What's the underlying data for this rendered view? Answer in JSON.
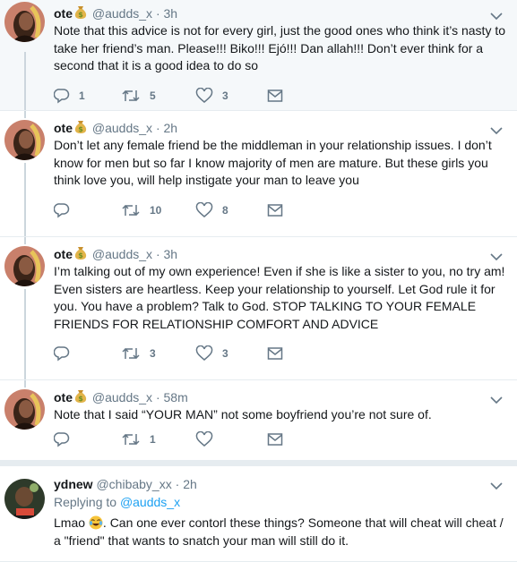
{
  "tweets": [
    {
      "name": "ote",
      "handle": "@audds_x",
      "dot": "·",
      "time": "3h",
      "text": "Note that this advice is not for every girl, just the good ones who think it’s nasty to take her friend’s man. Please!!! Biko!!! Ejó!!! Dan allah!!! Don’t ever think for a second that it is a good idea to do so",
      "replies": "1",
      "retweets": "5",
      "likes": "3"
    },
    {
      "name": "ote",
      "handle": "@audds_x",
      "dot": "·",
      "time": "2h",
      "text": "Don’t let any female friend be the middleman in your relationship issues. I don’t know for men but so far I know majority of men are mature. But these girls you think love you, will help instigate your man to leave you",
      "replies": "",
      "retweets": "10",
      "likes": "8"
    },
    {
      "name": "ote",
      "handle": "@audds_x",
      "dot": "·",
      "time": "3h",
      "text": "I’m talking out of my own experience! Even if she is like a sister to you, no try am! Even sisters are heartless. Keep your relationship to yourself. Let God rule it for you. You have a problem? Talk to God. STOP TALKING TO YOUR FEMALE FRIENDS FOR RELATIONSHIP COMFORT AND ADVICE",
      "replies": "",
      "retweets": "3",
      "likes": "3"
    },
    {
      "name": "ote",
      "handle": "@audds_x",
      "dot": "·",
      "time": "58m",
      "text": "Note that I said “YOUR MAN” not some boyfriend you’re not sure of.",
      "replies": "",
      "retweets": "1",
      "likes": ""
    },
    {
      "name": "ydnew",
      "handle": "@chibaby_xx",
      "dot": "·",
      "time": "2h",
      "replying_prefix": "Replying to",
      "replying_to": "@audds_x",
      "text_before_emoji": "Lmao ",
      "text_after_emoji": ". Can one ever contorl these things? Someone that will cheat will cheat / a \"friend\" that wants to snatch your man will still do it."
    }
  ],
  "icons": {
    "money_bag": "money-bag-emoji",
    "laughing": "face-with-tears-of-joy-emoji",
    "reply": "reply-icon",
    "retweet": "retweet-icon",
    "like": "heart-icon",
    "dm": "envelope-icon",
    "caret": "chevron-down-icon"
  },
  "colors": {
    "background": "#e6ecf0",
    "name": "#14171a",
    "secondary": "#657786",
    "link": "#1da1f2",
    "highlight": "#f5f8fa"
  }
}
